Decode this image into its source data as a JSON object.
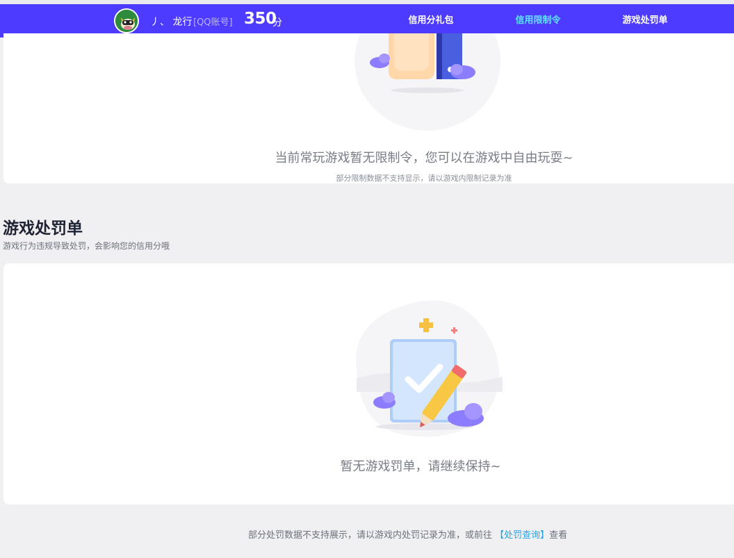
{
  "header": {
    "user_name": "丿、 龙行",
    "account_type": "[QQ账号]",
    "score": "350",
    "score_unit": "分",
    "tabs": [
      {
        "label": "信用分礼包",
        "active": false
      },
      {
        "label": "信用限制令",
        "active": true
      },
      {
        "label": "游戏处罚单",
        "active": false
      }
    ],
    "colors": {
      "bar": "#4d3bff",
      "active_tab": "#5fe3ff"
    }
  },
  "restriction": {
    "empty_message": "当前常玩游戏暂无限制令，您可以在游戏中自由玩耍~",
    "empty_note": "部分限制数据不支持显示，请以游戏内限制记录为准"
  },
  "penalty": {
    "title": "游戏处罚单",
    "subtitle": "游戏行为违规导致处罚，会影响您的信用分哦",
    "empty_message": "暂无游戏罚单，请继续保持~"
  },
  "footer": {
    "note_before": "部分处罚数据不支持展示，请以游戏内处罚记录为准，或前往 ",
    "link_label": "【处罚查询】",
    "note_after": "查看",
    "link_color": "#24a3e3"
  }
}
